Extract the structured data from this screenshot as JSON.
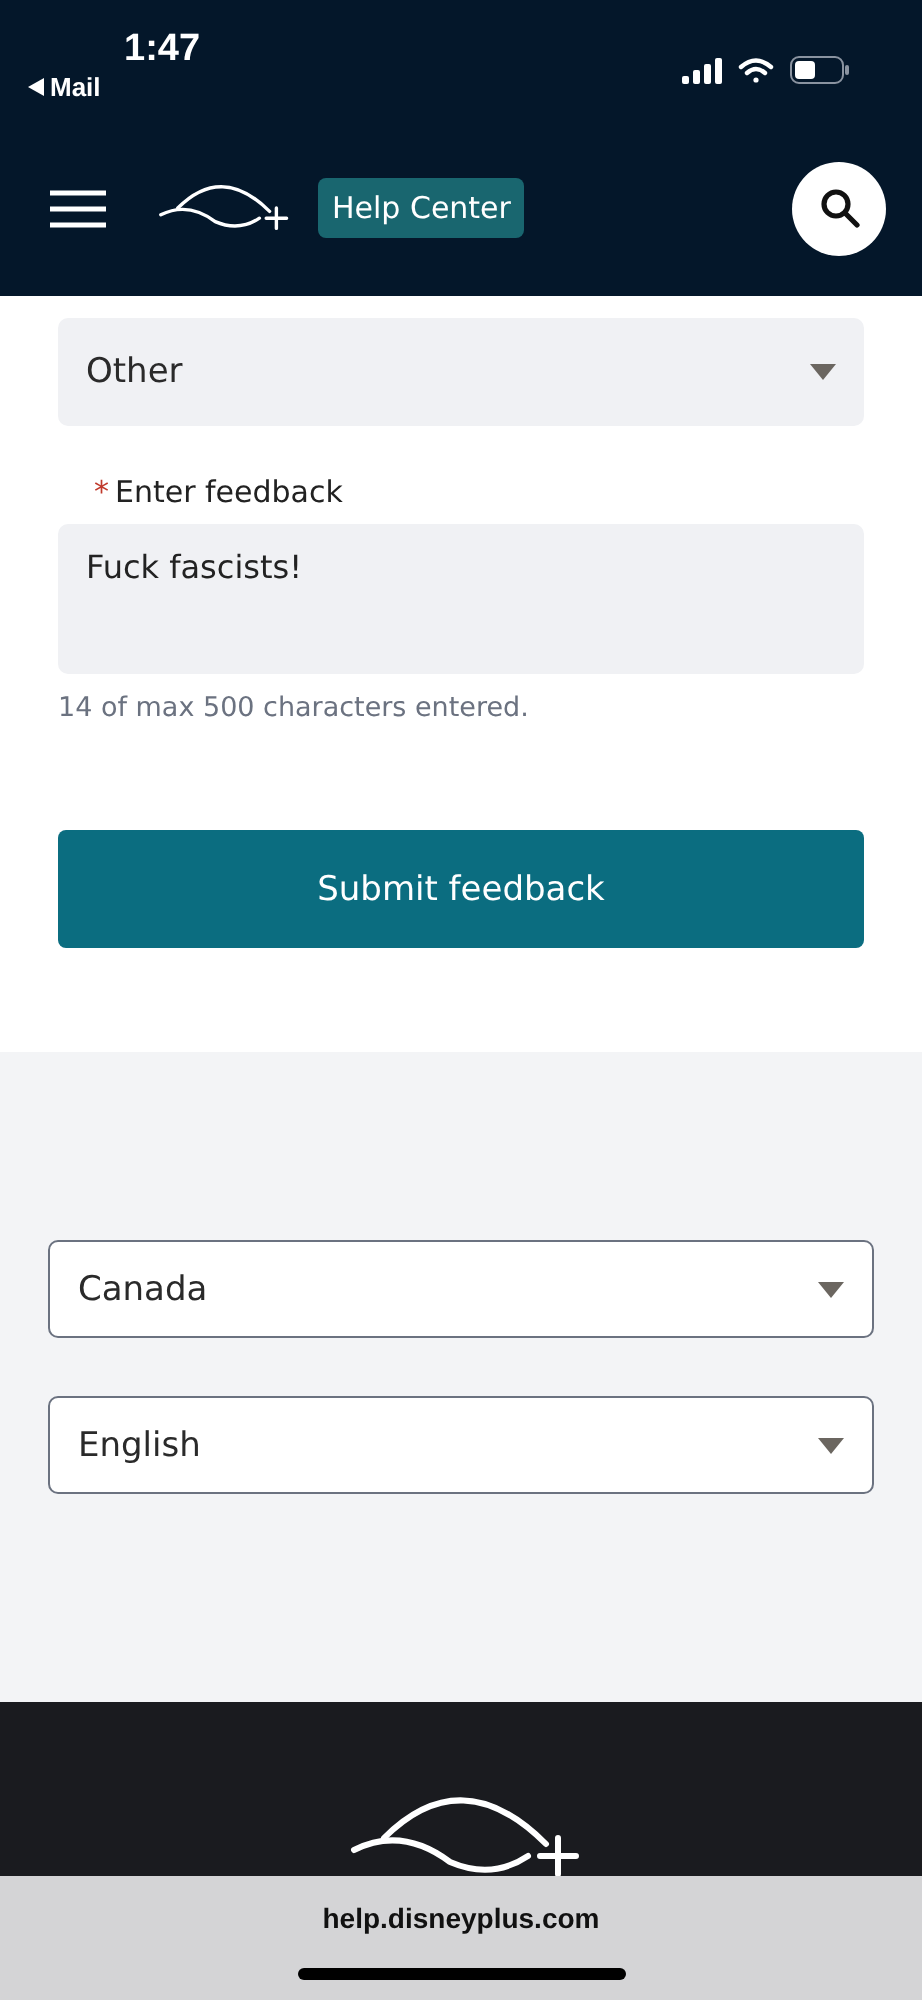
{
  "status_bar": {
    "time": "1:47",
    "back_label": "Mail"
  },
  "header": {
    "help_center": "Help Center"
  },
  "form": {
    "category": {
      "value": "Other"
    },
    "feedback": {
      "required_mark": "*",
      "label": "Enter feedback",
      "value": "Fuck fascists!"
    },
    "counter": "14 of max 500 characters entered.",
    "submit": "Submit feedback"
  },
  "region_selects": [
    {
      "value": "Canada"
    },
    {
      "value": "English"
    }
  ],
  "browser_bar": {
    "url": "help.disneyplus.com"
  }
}
